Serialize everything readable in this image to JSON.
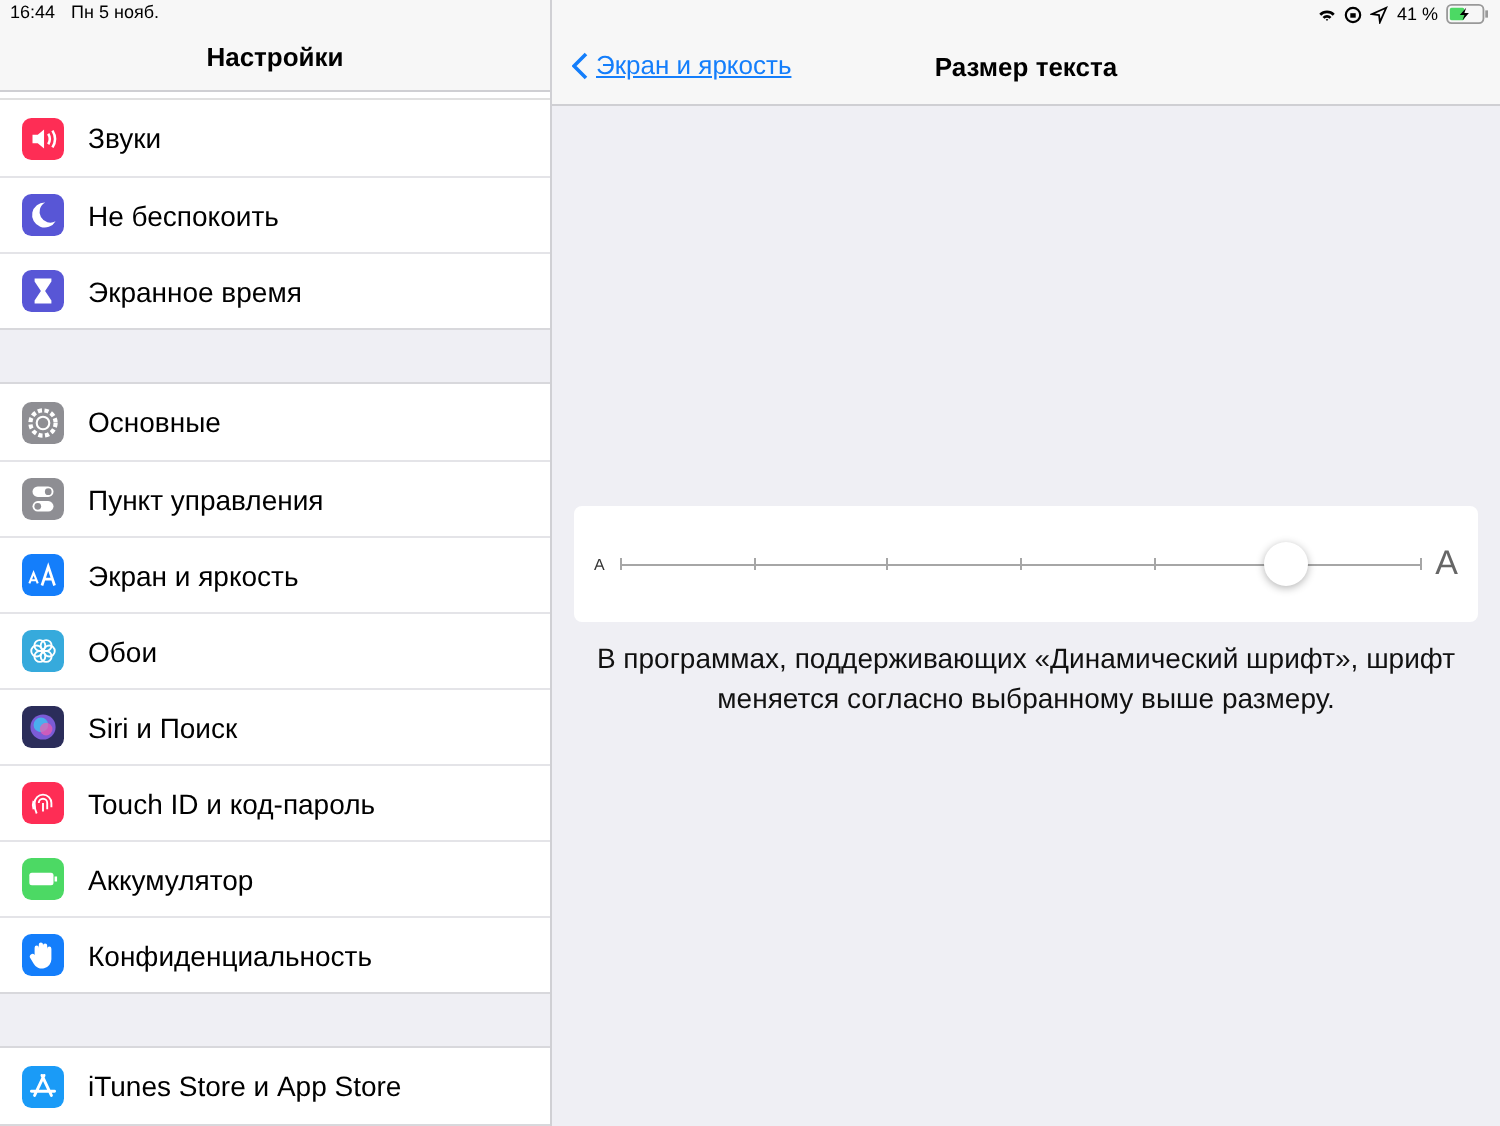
{
  "status_bar": {
    "time": "16:44",
    "date": "Пн 5 нояб.",
    "battery": "41 %"
  },
  "sidebar": {
    "title": "Настройки",
    "groups": [
      [
        {
          "label": "Звуки",
          "kind": "sound",
          "color": "#fe2d55"
        },
        {
          "label": "Не беспокоить",
          "kind": "moon",
          "color": "#5856d6"
        },
        {
          "label": "Экранное время",
          "kind": "hourglass",
          "color": "#5856d6"
        }
      ],
      [
        {
          "label": "Основные",
          "kind": "gear",
          "color": "#8e8e93"
        },
        {
          "label": "Пункт управления",
          "kind": "toggles",
          "color": "#8e8e93"
        },
        {
          "label": "Экран и яркость",
          "kind": "text",
          "color": "#147efb"
        },
        {
          "label": "Обои",
          "kind": "flower",
          "color": "#36aadc"
        },
        {
          "label": "Siri и Поиск",
          "kind": "siri",
          "color": "#2b2d5a"
        },
        {
          "label": "Touch ID и код-пароль",
          "kind": "fingerprint",
          "color": "#fe2d55"
        },
        {
          "label": "Аккумулятор",
          "kind": "battery",
          "color": "#4cd964"
        },
        {
          "label": "Конфиденциальность",
          "kind": "hand",
          "color": "#147efb"
        }
      ],
      [
        {
          "label": "iTunes Store и App Store",
          "kind": "store",
          "color": "#1a9bf7"
        }
      ]
    ]
  },
  "detail": {
    "back": "Экран и яркость",
    "title": "Размер текста",
    "slider": {
      "small_label": "A",
      "large_label": "A",
      "level": 0.833
    },
    "footnote": "В программах, поддерживающих «Динамический шрифт», шрифт меняется согласно выбранному выше размеру."
  }
}
